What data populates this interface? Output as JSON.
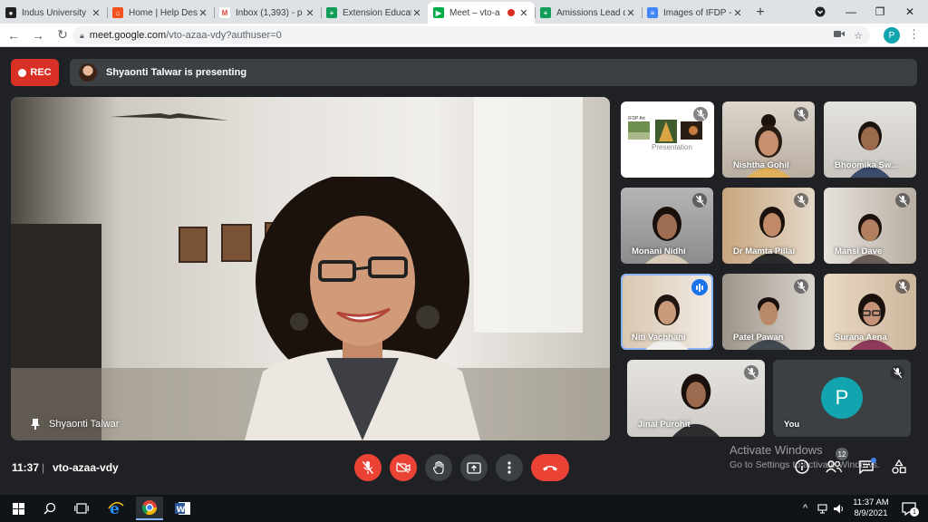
{
  "browser": {
    "tabs": [
      {
        "title": "Indus University",
        "icon": "indus-university-favicon",
        "active": false
      },
      {
        "title": "Home | Help Desk",
        "icon": "help-desk-favicon",
        "active": false
      },
      {
        "title": "Inbox (1,393) - p",
        "icon": "gmail-favicon",
        "active": false
      },
      {
        "title": "Extension Educat",
        "icon": "sheets-favicon",
        "active": false
      },
      {
        "title": "Meet – vto-a",
        "icon": "meet-favicon",
        "active": true,
        "recording": true
      },
      {
        "title": "Amissions Lead d",
        "icon": "sheets-favicon",
        "active": false
      },
      {
        "title": "Images of IFDP -",
        "icon": "docs-favicon",
        "active": false
      }
    ],
    "new_tab": "+",
    "address": {
      "host": "meet.google.com",
      "path": "/vto-azaa-vdy?authuser=0"
    },
    "profile_initial": "P"
  },
  "meet": {
    "rec_label": "REC",
    "presenting_text": "Shyaonti Talwar is presenting",
    "main_speaker": "Shyaonti Talwar",
    "participants": [
      {
        "name": "",
        "type": "slide",
        "slide_title": "IFDP Art",
        "slide_caption": "Presentation"
      },
      {
        "name": "Nishtha Gohil",
        "muted": true
      },
      {
        "name": "Bhoomika Sw...",
        "muted": false
      },
      {
        "name": "Monani Nidhi",
        "muted": true
      },
      {
        "name": "Dr Mamta Pillai",
        "muted": true
      },
      {
        "name": "Mansi Dave",
        "muted": true
      },
      {
        "name": "Niti Vachhani",
        "muted": false,
        "speaking": true
      },
      {
        "name": "Patel Pawan",
        "muted": true
      },
      {
        "name": "Surana Aena",
        "muted": true
      },
      {
        "name": "Jinal Purohit",
        "muted": true
      },
      {
        "name": "You",
        "muted": true,
        "avatar_initial": "P"
      }
    ],
    "time": "11:37",
    "separator": "|",
    "meeting_code": "vto-azaa-vdy",
    "participant_count": "12",
    "controls": [
      "mic-off",
      "camera-off",
      "raise-hand",
      "present-screen",
      "more-options",
      "leave-call"
    ]
  },
  "watermark": {
    "title": "Activate Windows",
    "subtitle": "Go to Settings to activate Windows."
  },
  "taskbar": {
    "time": "11:37 AM",
    "date": "8/9/2021",
    "notification_count": "1"
  },
  "colors": {
    "meet_bg": "#202124",
    "danger": "#ea4335",
    "accent": "#1a73e8",
    "avatar": "#12a4af"
  }
}
